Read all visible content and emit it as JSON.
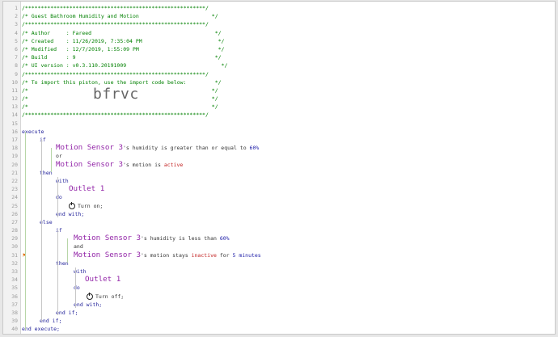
{
  "gutter": [
    "1",
    "2",
    "3",
    "4",
    "5",
    "6",
    "7",
    "8",
    "9",
    "10",
    "11",
    "12",
    "13",
    "14",
    "15",
    "16",
    "17",
    "18",
    "19",
    "20",
    "21",
    "22",
    "23",
    "24",
    "25",
    "26",
    "27",
    "28",
    "29",
    "30",
    "31",
    "32",
    "33",
    "34",
    "35",
    "36",
    "37",
    "38",
    "39",
    "40"
  ],
  "header": {
    "border": "/*********************************************************/",
    "title": "/* Guest Bathroom Humidity and Motion                       */",
    "sep": "/*********************************************************/",
    "author": "/* Author     : Fareed                                       */",
    "created": "/* Created    : 11/26/2019, 7:35:04 PM                        */",
    "modified": "/* Modified   : 12/7/2019, 1:55:09 PM                         */",
    "build": "/* Build      : 9                                            */",
    "ui": "/* UI version : v0.3.110.20191009                              */",
    "sep2": "/*********************************************************/",
    "import_line": "/* To import this piston, use the import code below:         */",
    "blank1": "/*                                                          */",
    "blank2": "/*                                                          */",
    "blank3": "/*                                                          */",
    "border_end": "/*********************************************************/",
    "import_code": "bfrvc"
  },
  "code": {
    "execute": "execute",
    "if": "if",
    "dev_motion": "Motion Sensor 3",
    "humidity_gte": "'s humidity is greater than or equal to ",
    "val_60a": "60%",
    "or": "or",
    "motion_is": "'s motion is ",
    "active": "active",
    "then": "then",
    "with": "with",
    "outlet": "Outlet 1",
    "do": "do",
    "turn_on": "Turn on;",
    "end_with": "end with;",
    "else": "else",
    "humidity_lt": "'s humidity is less than ",
    "val_60b": "60%",
    "and": "and",
    "motion_stays": "'s motion stays ",
    "inactive": "inactive",
    "for_text": " for ",
    "minutes": "5 minutes",
    "turn_off": "Turn off;",
    "end_if": "end if;",
    "end_execute": "end execute;"
  },
  "colors": {
    "comment": "#008000",
    "keyword": "#22229a",
    "device": "#9326a8",
    "value": "#c22020",
    "guide": "#b8d6a8"
  }
}
